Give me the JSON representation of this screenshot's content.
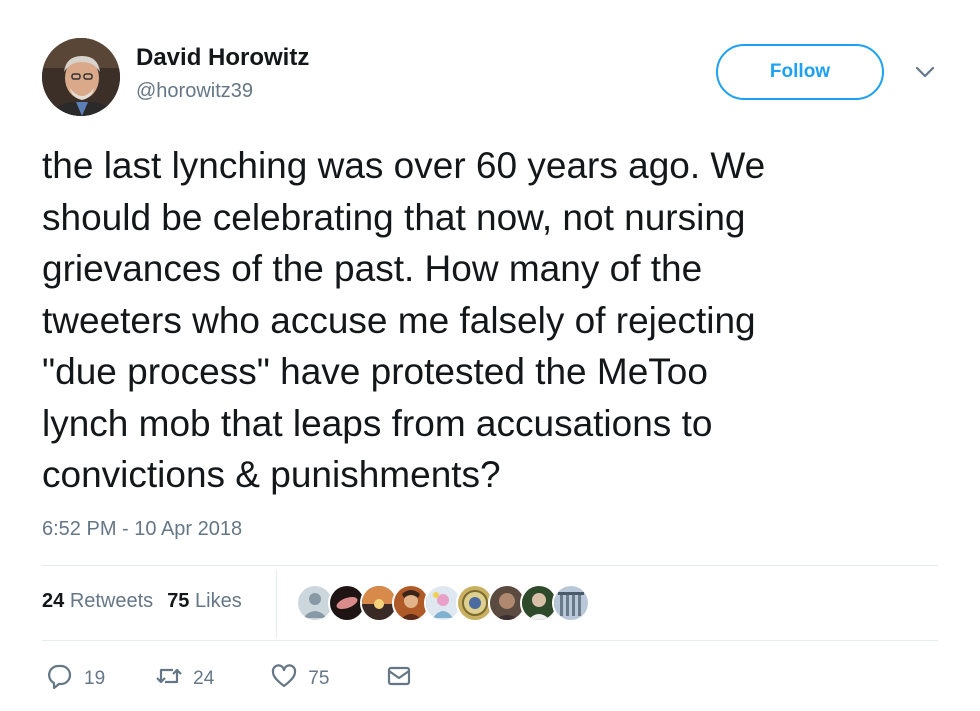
{
  "author": {
    "name": "David Horowitz",
    "handle": "@horowitz39"
  },
  "follow_label": "Follow",
  "tweet": {
    "lines": [
      "the last lynching was over 60 years ago. We",
      "should be celebrating that now, not nursing",
      "grievances of the past. How many of the",
      "tweeters who accuse me falsely of rejecting",
      "\"due process\" have protested the MeToo",
      "lynch mob that leaps from accusations to",
      "convictions & punishments?"
    ],
    "timestamp": "6:52 PM - 10 Apr 2018"
  },
  "stats": {
    "retweets_count": "24",
    "retweets_label": "Retweets",
    "likes_count": "75",
    "likes_label": "Likes"
  },
  "likers": [
    {
      "icon": "default-avatar",
      "color": "#aab8c2"
    },
    {
      "icon": "avatar-2",
      "color": "#2b1d1a"
    },
    {
      "icon": "avatar-3",
      "color": "#c07a3c"
    },
    {
      "icon": "avatar-4",
      "color": "#8a4b2a"
    },
    {
      "icon": "avatar-5",
      "color": "#c9a3c8"
    },
    {
      "icon": "avatar-6",
      "color": "#b59a3c"
    },
    {
      "icon": "avatar-7",
      "color": "#6b5a4c"
    },
    {
      "icon": "avatar-8",
      "color": "#3d6b3a"
    },
    {
      "icon": "avatar-9",
      "color": "#8aa4c0"
    }
  ],
  "actions": {
    "replies": "19",
    "retweets": "24",
    "likes": "75"
  },
  "colors": {
    "accent": "#1da1f2",
    "secondary_text": "#657786",
    "primary_text": "#14171a",
    "divider": "#e6ecf0"
  }
}
